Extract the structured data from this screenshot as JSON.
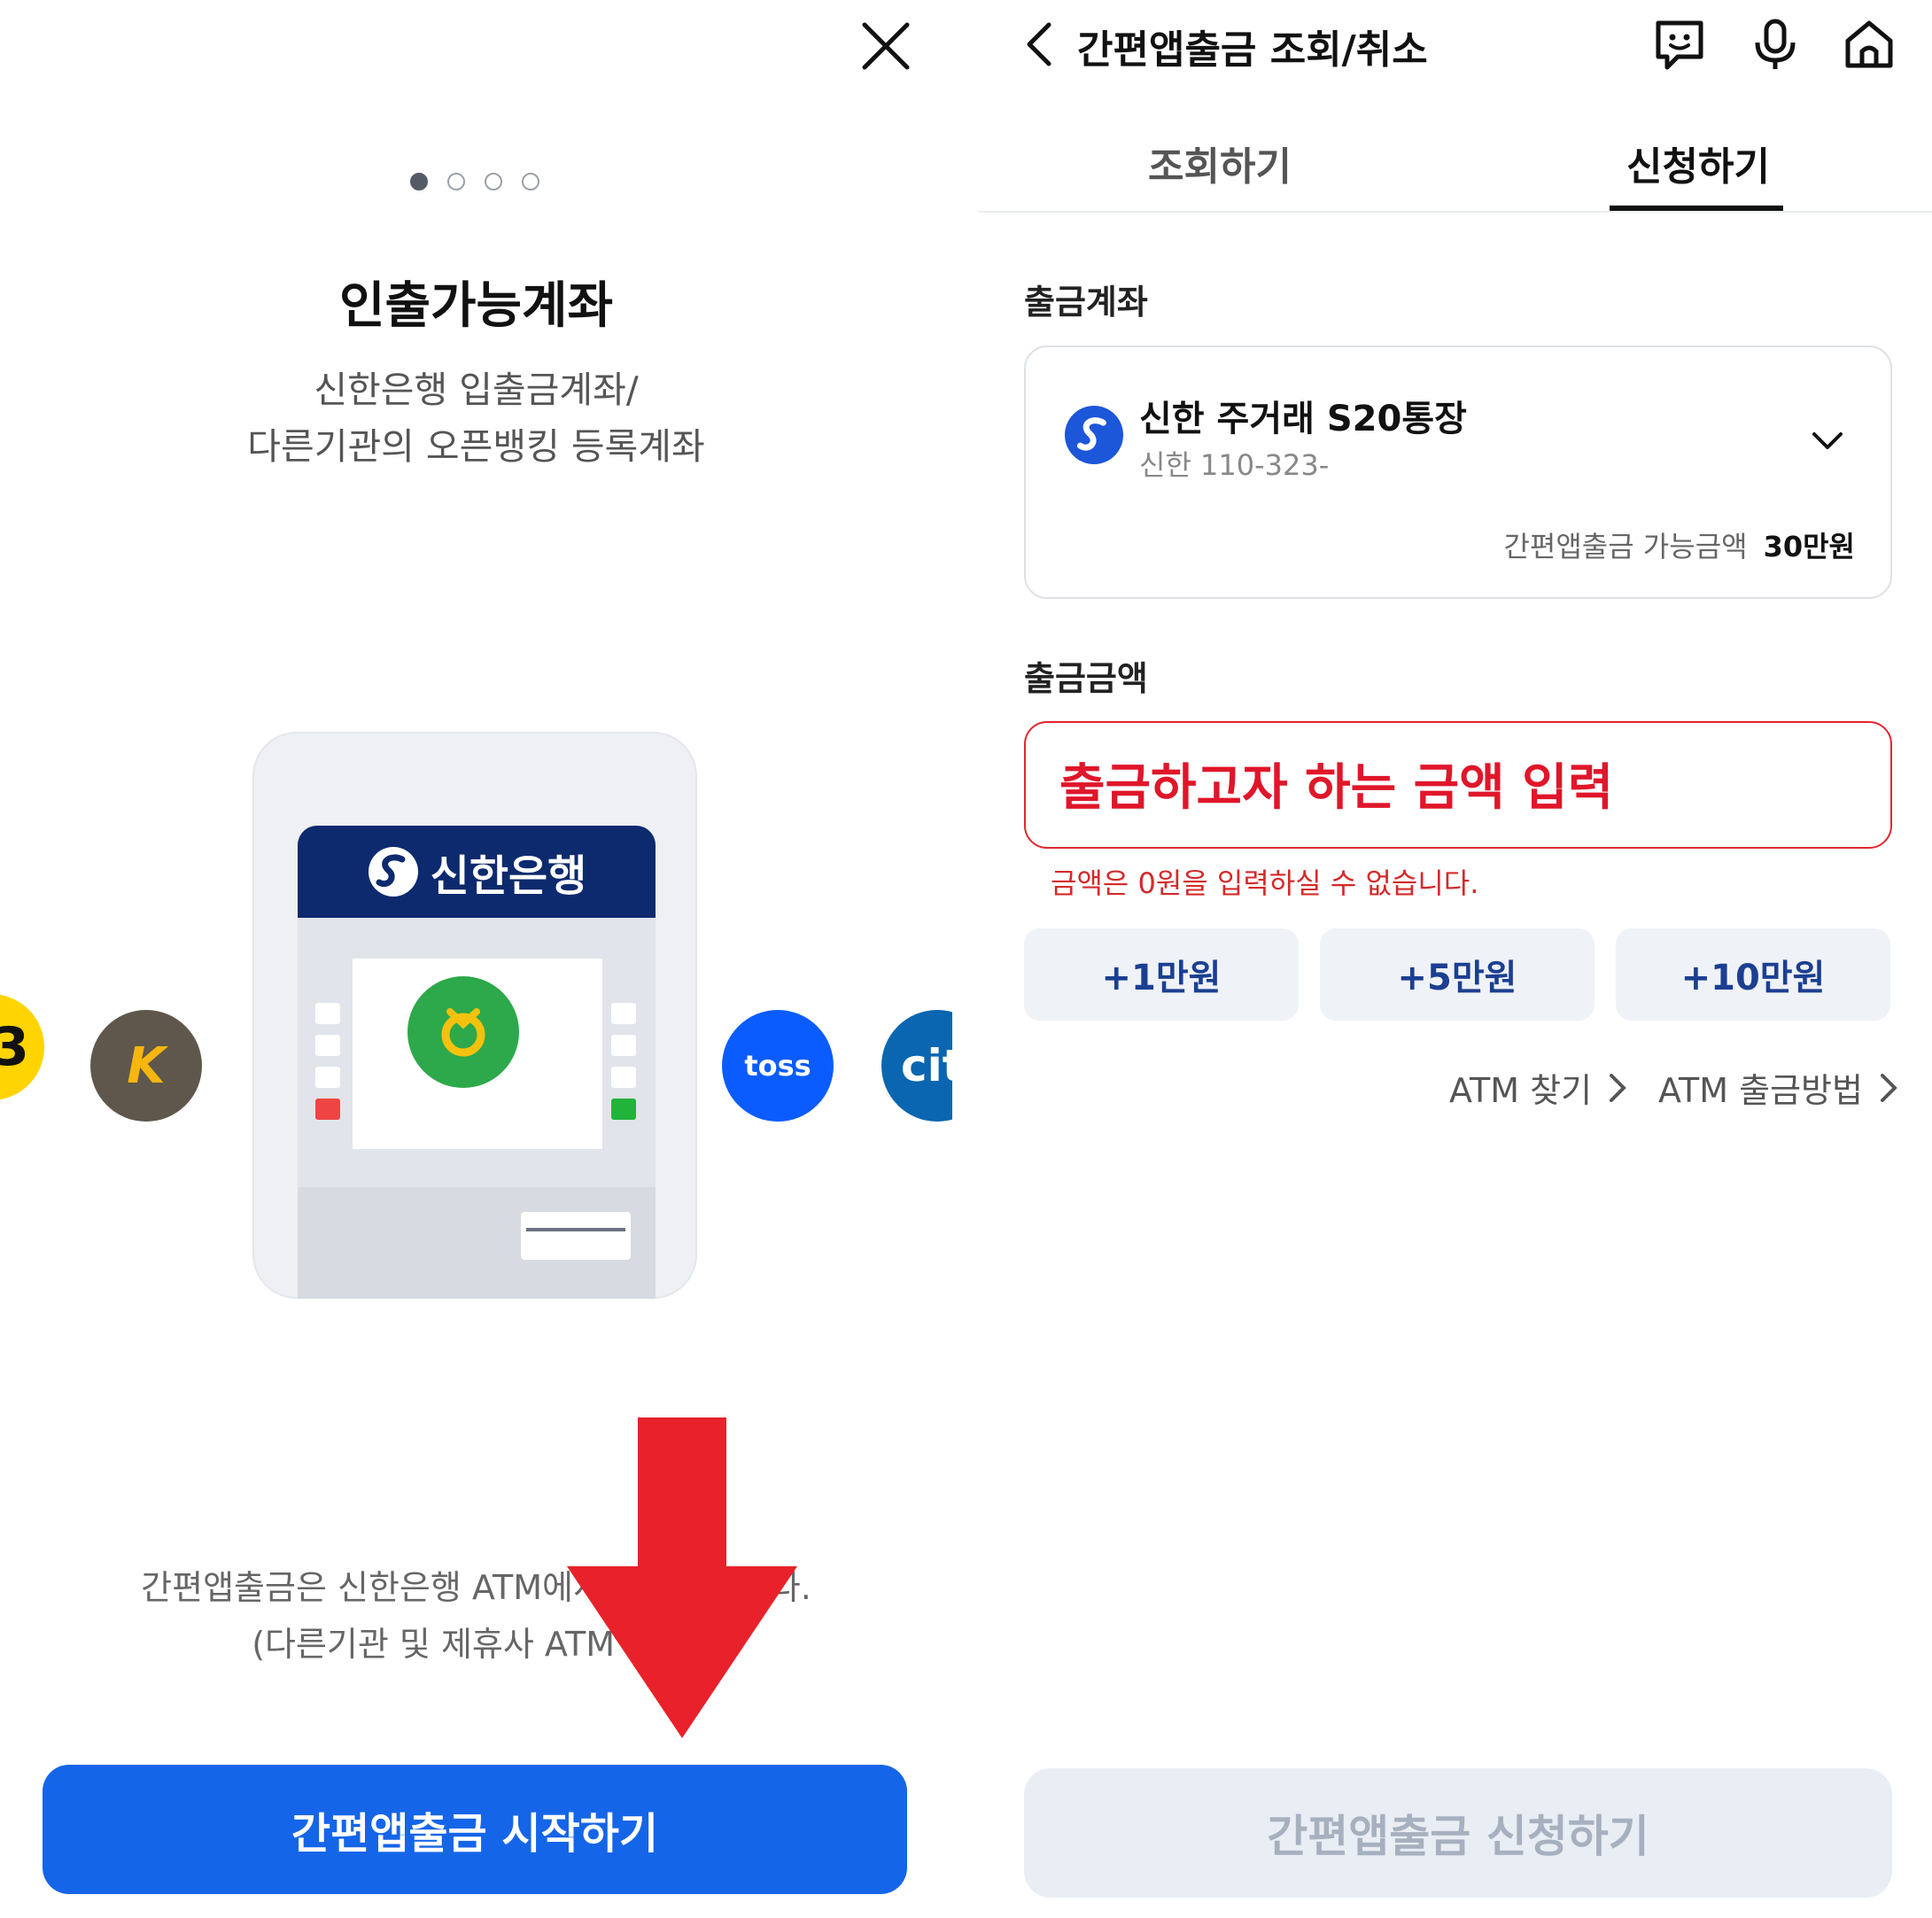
{
  "left": {
    "pager": {
      "total": 4,
      "active": 1
    },
    "slide_title": "인출가능계좌",
    "slide_desc_line1": "신한은행 입출금계좌/",
    "slide_desc_line2": "다른기관의 오픈뱅킹 등록계좌",
    "atm_brand": "신한은행",
    "bank_logos": {
      "kb": "K",
      "toss": "toss",
      "citi": "cit"
    },
    "notice_line1": "간편앱출금은 신한은행 ATM에서만 가능합니다.",
    "notice_line2": "(다른기관 및 제휴사 ATM 불가)",
    "start_button": "간편앱출금 시작하기",
    "colors": {
      "primary": "#1565e8",
      "arrow": "#e8212a",
      "atm_header": "#0d2a6e"
    }
  },
  "right": {
    "header_title": "간편앱출금 조회/취소",
    "header_icons": [
      "chatbot-icon",
      "microphone-icon",
      "home-icon"
    ],
    "tabs": [
      {
        "label": "조회하기",
        "active": false
      },
      {
        "label": "신청하기",
        "active": true
      }
    ],
    "account_section_label": "출금계좌",
    "account": {
      "name": "신한 주거래 S20통장",
      "number": "신한 110-323-",
      "available_label": "간편앱출금 가능금액",
      "available_value": "30만원"
    },
    "amount_section_label": "출금금액",
    "amount_overlay": "출금하고자 하는 금액 입력",
    "amount_error": "금액은 0원을 입력하실 수 없습니다.",
    "quick_amounts": [
      "+1만원",
      "+5만원",
      "+10만원"
    ],
    "links": [
      "ATM 찾기",
      "ATM 출금방법"
    ],
    "apply_button": "간편앱출금 신청하기",
    "colors": {
      "error": "#e22630",
      "quick_text": "#1b3f91",
      "disabled_bg": "#e9edf4"
    }
  }
}
